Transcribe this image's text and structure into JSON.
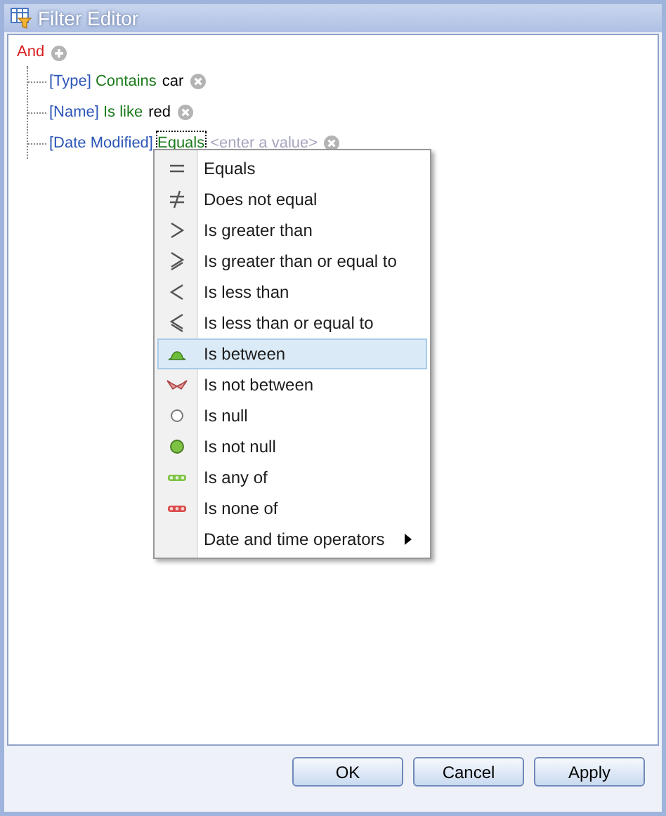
{
  "window": {
    "title": "Filter Editor"
  },
  "group": {
    "operator": "And"
  },
  "conditions": [
    {
      "field": "[Type]",
      "operator": "Contains",
      "value": "car",
      "focused": false
    },
    {
      "field": "[Name]",
      "operator": "Is like",
      "value": "red",
      "focused": false
    },
    {
      "field": "[Date Modified]",
      "operator": "Equals",
      "placeholder": "<enter a value>",
      "focused": true
    }
  ],
  "menu": {
    "items": [
      {
        "label": "Equals",
        "kind": "equals",
        "selected": false
      },
      {
        "label": "Does not equal",
        "kind": "not-equal",
        "selected": false
      },
      {
        "label": "Is greater than",
        "kind": "greater",
        "selected": false
      },
      {
        "label": "Is greater than or equal to",
        "kind": "greater-equal",
        "selected": false
      },
      {
        "label": "Is less than",
        "kind": "less",
        "selected": false
      },
      {
        "label": "Is less than or equal to",
        "kind": "less-equal",
        "selected": false
      },
      {
        "label": "Is between",
        "kind": "between",
        "selected": true
      },
      {
        "label": "Is not between",
        "kind": "not-between",
        "selected": false
      },
      {
        "label": "Is null",
        "kind": "null",
        "selected": false
      },
      {
        "label": "Is not null",
        "kind": "not-null",
        "selected": false
      },
      {
        "label": "Is any of",
        "kind": "any-of",
        "selected": false
      },
      {
        "label": "Is none of",
        "kind": "none-of",
        "selected": false
      },
      {
        "label": "Date and time operators",
        "kind": "submenu",
        "selected": false
      }
    ]
  },
  "buttons": [
    "OK",
    "Cancel",
    "Apply"
  ]
}
